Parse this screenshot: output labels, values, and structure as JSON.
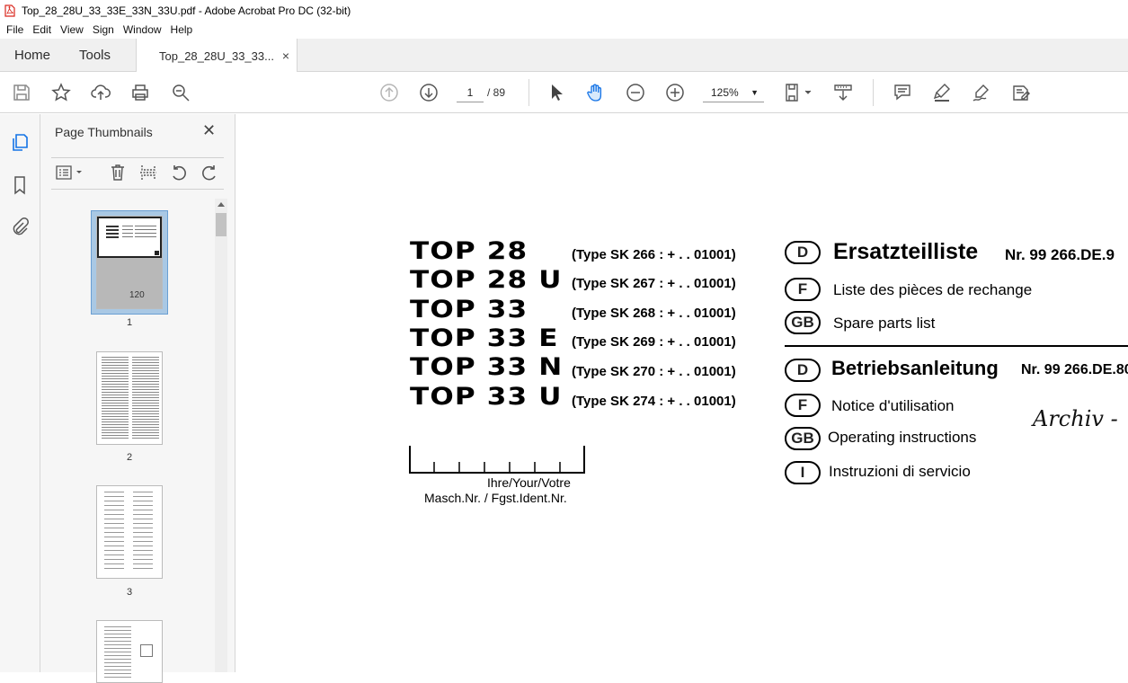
{
  "window": {
    "title": "Top_28_28U_33_33E_33N_33U.pdf - Adobe Acrobat Pro DC (32-bit)",
    "accent_color": "#d9261c"
  },
  "menu": [
    "File",
    "Edit",
    "View",
    "Sign",
    "Window",
    "Help"
  ],
  "tabs": {
    "home": "Home",
    "tools": "Tools",
    "document": "Top_28_28U_33_33...",
    "close": "×"
  },
  "toolbar": {
    "current_page": "1",
    "page_total": "/ 89",
    "zoom": "125%",
    "icons": [
      "save-icon",
      "bookmark-star-icon",
      "upload-cloud-icon",
      "print-icon",
      "search-icon",
      "page-up-icon",
      "page-down-icon",
      "select-arrow-icon",
      "hand-tool-icon",
      "zoom-out-icon",
      "zoom-in-icon",
      "page-fit-icon",
      "scroll-mode-icon",
      "comment-icon",
      "highlight-icon",
      "sign-icon",
      "fill-sign-icon"
    ]
  },
  "left_rail": {
    "icons": [
      "pages-icon",
      "bookmark-icon",
      "attachment-icon"
    ]
  },
  "thumbnails_panel": {
    "title": "Page Thumbnails",
    "close": "✕",
    "pages": [
      {
        "number": "1"
      },
      {
        "number": "2"
      },
      {
        "number": "3"
      }
    ],
    "page1_logo": "120"
  },
  "document": {
    "models": [
      "TOP  28",
      "TOP  28 U",
      "TOP  33",
      "TOP  33  E",
      "TOP  33  N",
      "TOP  33  U"
    ],
    "types": [
      "(Type SK 266 : + . . 01001)",
      "(Type SK 267 : + . . 01001)",
      "(Type SK 268 : + . . 01001)",
      "(Type SK 269 : + . . 01001)",
      "(Type SK 270 : + . . 01001)",
      "(Type SK 274 : + . . 01001)"
    ],
    "ident_label_1": "Ihre/Your/Votre",
    "ident_label_2": "Masch.Nr. / Fgst.Ident.Nr.",
    "parts": {
      "heading": "Ersatzteilliste",
      "nr": "Nr. 99 266.DE.9",
      "lines": [
        {
          "badge": "D",
          "text": ""
        },
        {
          "badge": "F",
          "text": "Liste des pièces de rechange"
        },
        {
          "badge": "GB",
          "text": "Spare parts list"
        }
      ]
    },
    "manual": {
      "heading": "Betriebsanleitung",
      "nr": "Nr. 99 266.DE.80",
      "lines": [
        {
          "badge": "D",
          "text": ""
        },
        {
          "badge": "F",
          "text": "Notice d'utilisation"
        },
        {
          "badge": "GB",
          "text": "Operating instructions"
        },
        {
          "badge": "I",
          "text": "Instruzioni di servicio"
        }
      ]
    },
    "handwritten_note": "Archiv -"
  }
}
